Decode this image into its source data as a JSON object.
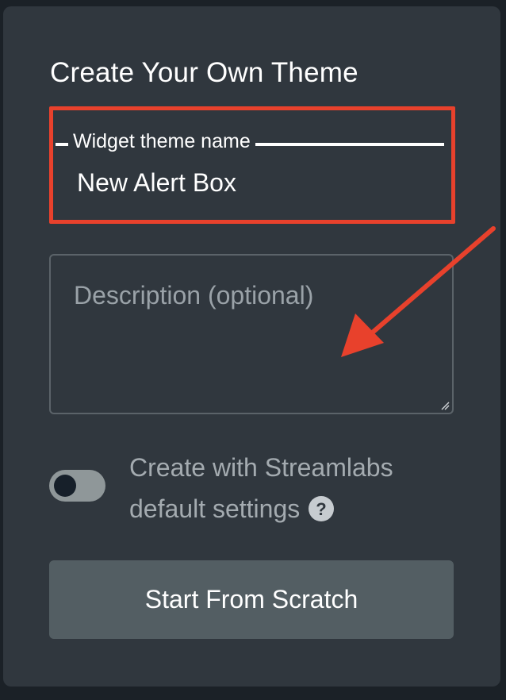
{
  "panel": {
    "title": "Create Your Own Theme"
  },
  "name_field": {
    "label": "Widget theme name",
    "value": "New Alert Box"
  },
  "description_field": {
    "placeholder": "Description (optional)"
  },
  "defaults_toggle": {
    "label_line1": "Create with Streamlabs",
    "label_line2": "default settings",
    "state": "off",
    "help_icon": "question-circle-icon"
  },
  "start_button": {
    "label": "Start From Scratch"
  },
  "annotations": {
    "highlight_color": "#e8412c",
    "arrow_color": "#e8412c",
    "arrow_icon": "annotation-arrow"
  },
  "colors": {
    "panel_background": "#30373e",
    "page_background": "#1b2127",
    "button_background": "#535e63",
    "toggle_track": "#8f9799"
  }
}
